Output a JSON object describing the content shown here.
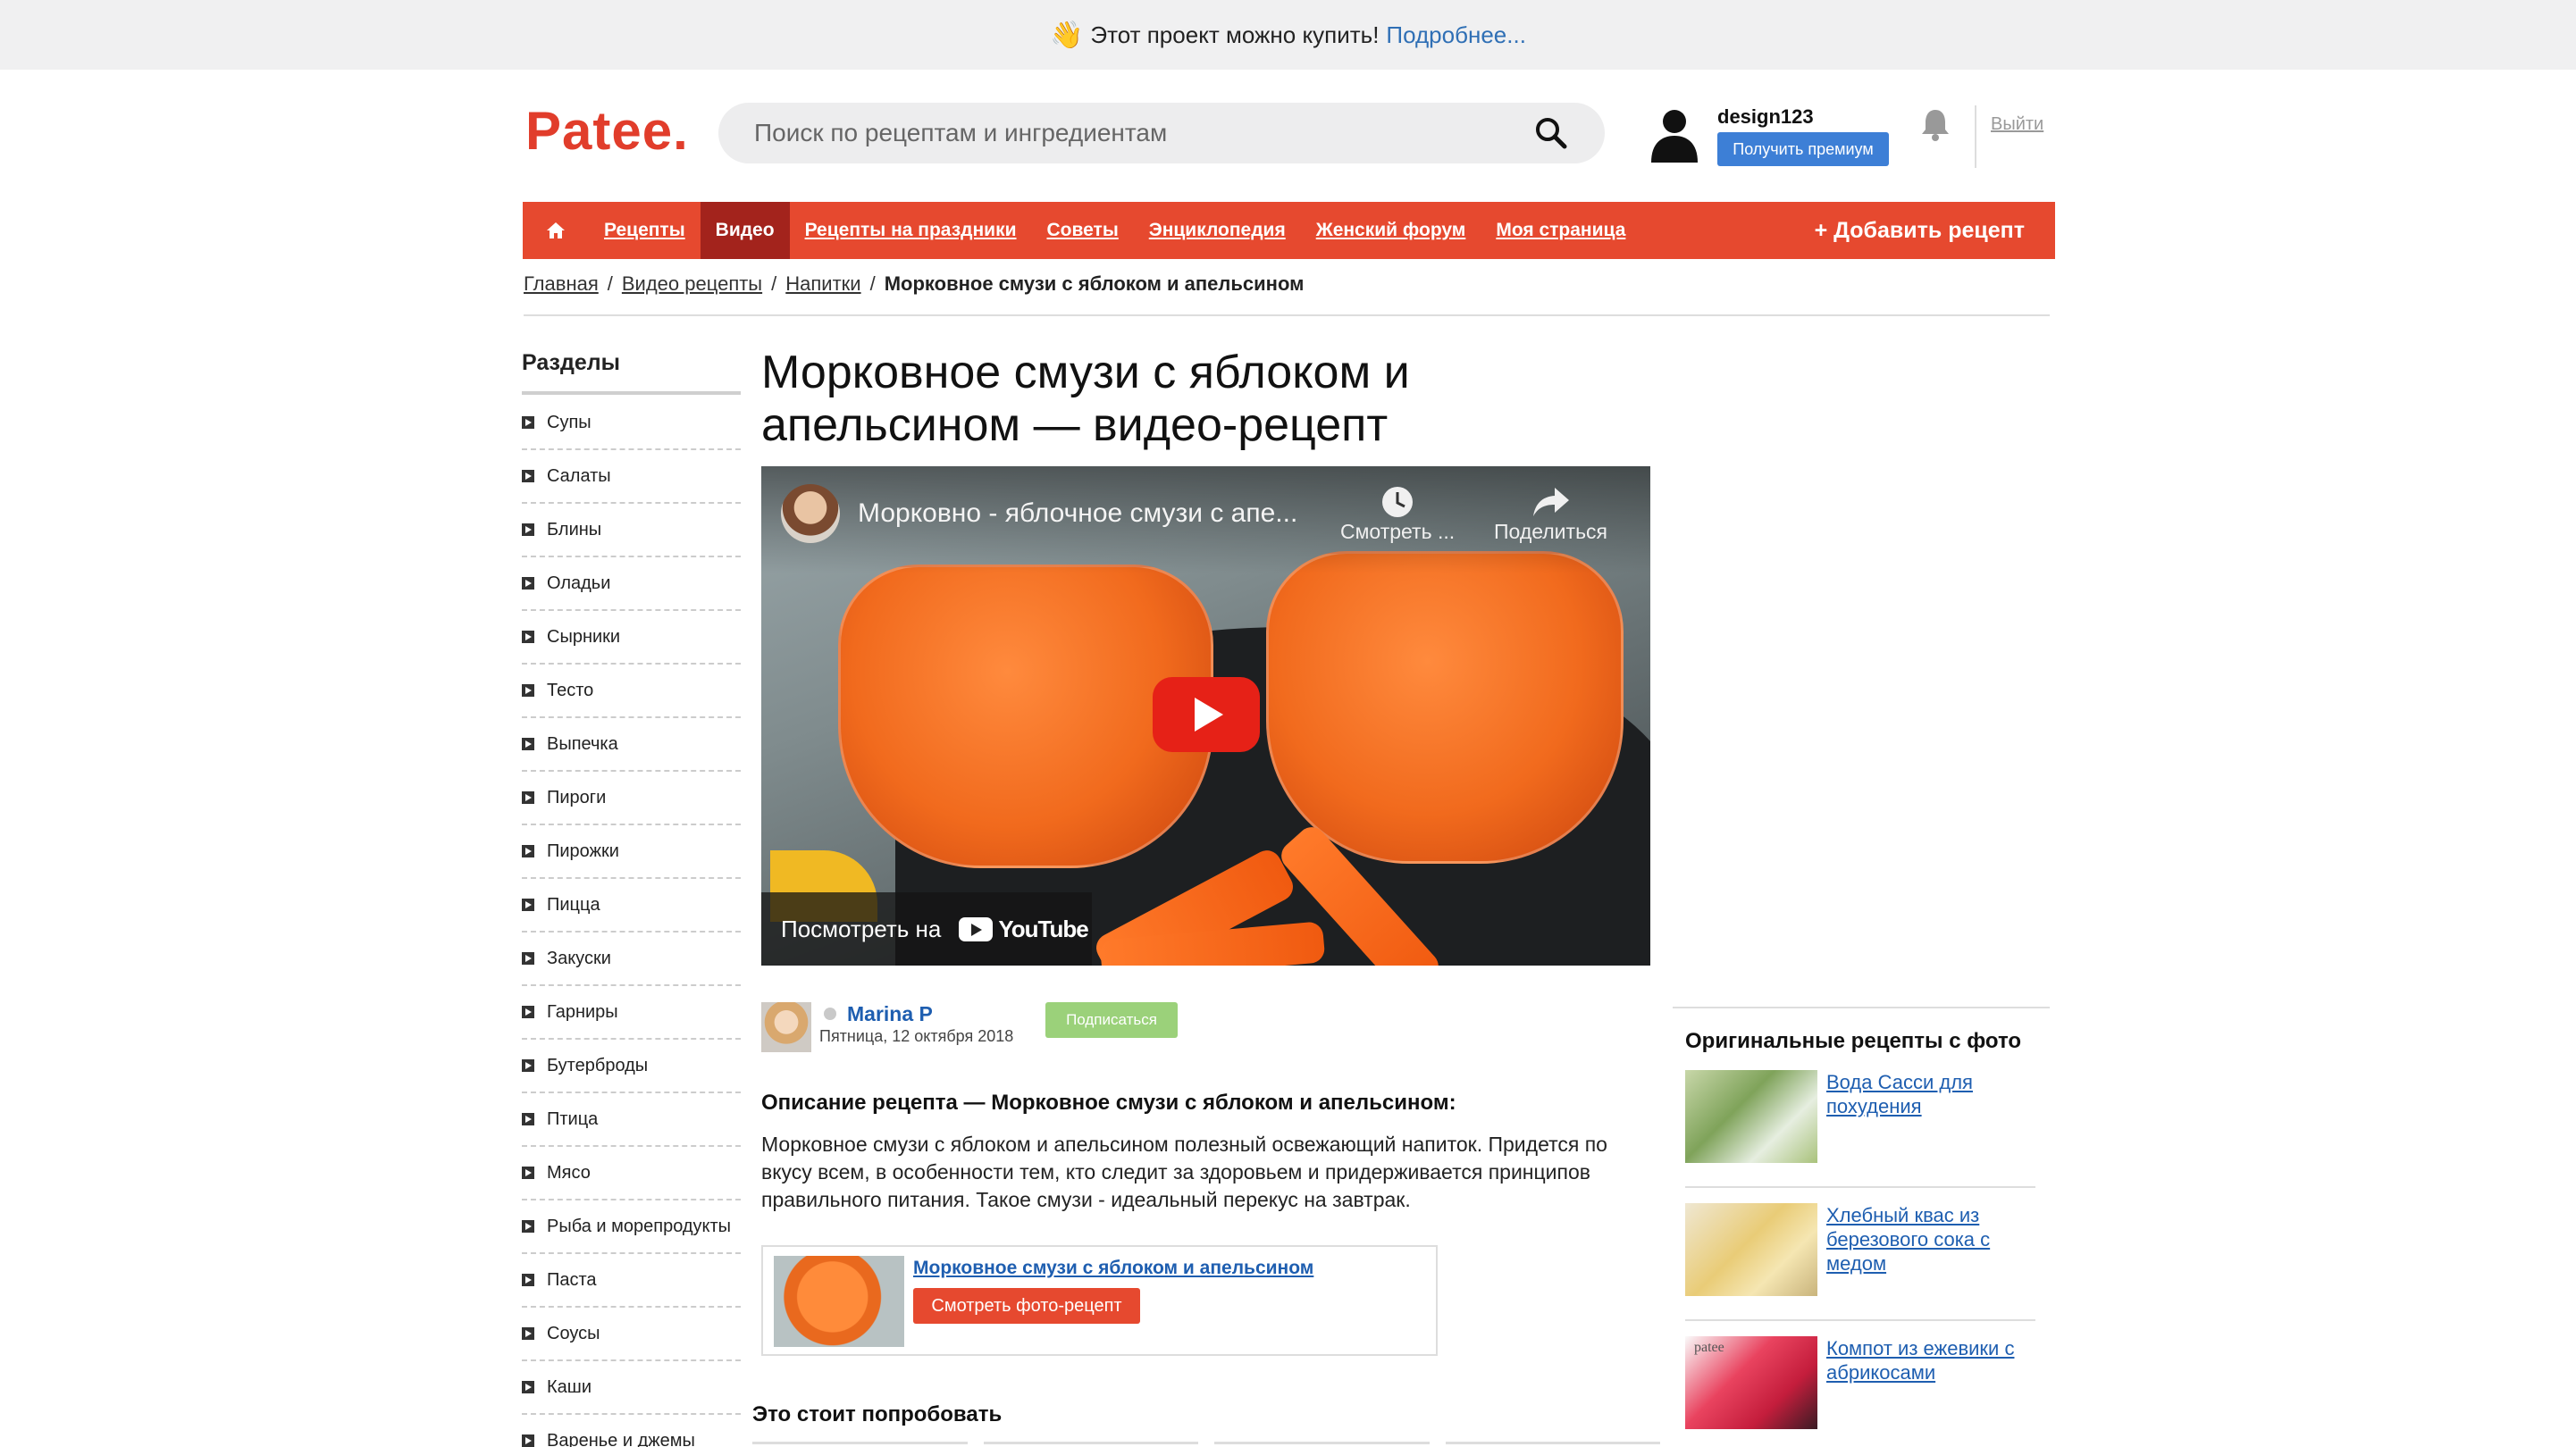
{
  "promo": {
    "emoji": "👋",
    "text": "Этот проект можно купить!",
    "link": "Подробнее..."
  },
  "header": {
    "logo": "Patee.",
    "search_placeholder": "Поиск по рецептам и ингредиентам",
    "username": "design123",
    "premium_label": "Получить премиум",
    "logout_label": "Выйти"
  },
  "nav": {
    "items": [
      "Рецепты",
      "Видео",
      "Рецепты на праздники",
      "Советы",
      "Энциклопедия",
      "Женский форум",
      "Моя страница"
    ],
    "active_index": 1,
    "add_label": "+ Добавить рецепт",
    "accent": "#e6492f",
    "active_color": "#a3231c"
  },
  "breadcrumb": {
    "items": [
      "Главная",
      "Видео рецепты",
      "Напитки"
    ],
    "current": "Морковное смузи с яблоком и апельсином"
  },
  "sidebar": {
    "title": "Разделы",
    "items": [
      "Супы",
      "Салаты",
      "Блины",
      "Оладьи",
      "Сырники",
      "Тесто",
      "Выпечка",
      "Пироги",
      "Пирожки",
      "Пицца",
      "Закуски",
      "Гарниры",
      "Бутерброды",
      "Птица",
      "Мясо",
      "Рыба и морепродукты",
      "Паста",
      "Соусы",
      "Каши",
      "Варенье и джемы"
    ]
  },
  "main": {
    "title": "Морковное смузи с яблоком и апельсином — видео-рецепт",
    "video": {
      "title": "Морковно - яблочное смузи с апе...",
      "watch_later": "Смотреть ...",
      "share": "Поделиться",
      "watch_on": "Посмотреть на",
      "youtube": "YouTube"
    },
    "author": {
      "name": "Marina P",
      "date": "Пятница, 12 октября 2018",
      "subscribe_label": "Подписаться"
    },
    "description_heading": "Описание рецепта — Морковное смузи с яблоком и апельсином:",
    "description": "Морковное смузи с яблоком и апельсином полезный освежающий напиток. Придется по вкусу всем, в особенности тем, кто следит за здоровьем и придерживается принципов правильного питания. Такое смузи - идеальный перекус на завтрак.",
    "card": {
      "link": "Морковное смузи с яблоком и апельсином",
      "button": "Смотреть фото-рецепт"
    },
    "try_heading": "Это стоит попробовать"
  },
  "right": {
    "title": "Оригинальные рецепты с фото",
    "items": [
      {
        "label": "Вода Сасси для похудения"
      },
      {
        "label": "Хлебный квас из березового сока с медом"
      },
      {
        "label": "Компот из ежевики с абрикосами",
        "thumb_text": "patee"
      }
    ]
  }
}
